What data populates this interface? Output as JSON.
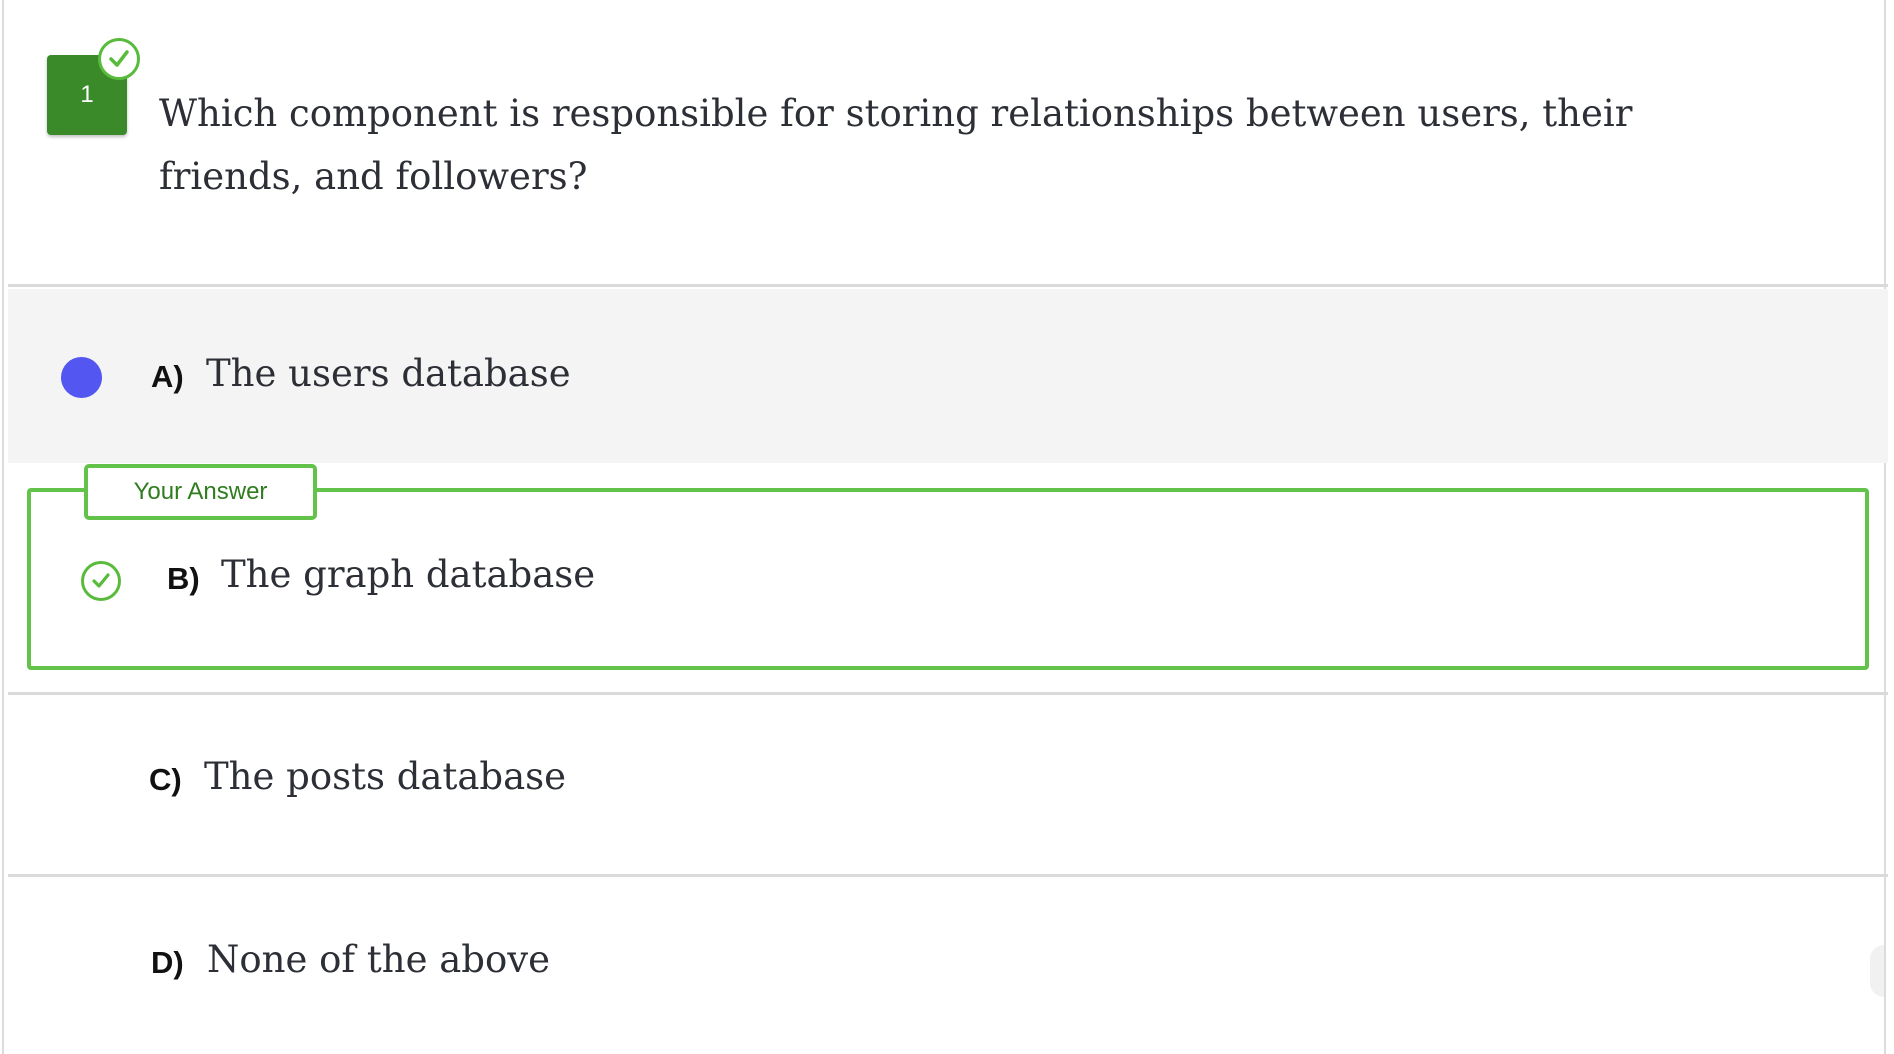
{
  "question": {
    "number": "1",
    "text": "Which component is responsible for storing relationships between users, their friends, and followers?",
    "status_icon": "check-circle-icon"
  },
  "your_answer_label": "Your Answer",
  "options": [
    {
      "letter": "A)",
      "text": "The users database",
      "state": "highlighted",
      "marker": "filled-dot"
    },
    {
      "letter": "B)",
      "text": "The graph database",
      "state": "your-answer-correct",
      "marker": "check-circle-icon"
    },
    {
      "letter": "C)",
      "text": "The posts database",
      "state": "default",
      "marker": ""
    },
    {
      "letter": "D)",
      "text": "None of the above",
      "state": "default",
      "marker": ""
    }
  ],
  "colors": {
    "correct_green": "#63c24a",
    "number_badge_green": "#3a8a2a",
    "selected_dot": "#5356f0",
    "highlight_bg": "#f4f4f4",
    "text": "#2d2f36"
  }
}
